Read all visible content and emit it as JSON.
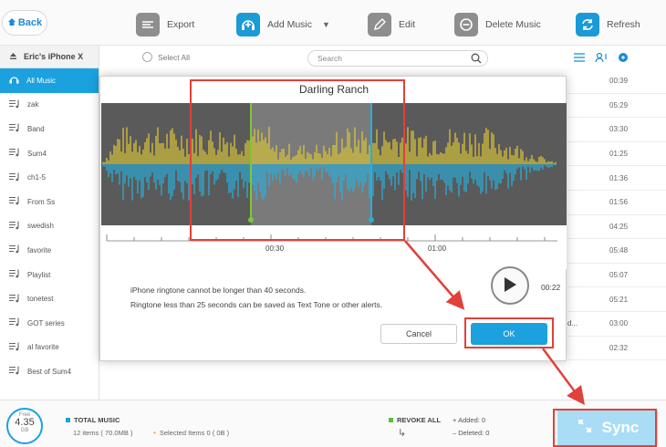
{
  "toolbar": {
    "back_label": "Back",
    "export_label": "Export",
    "add_music_label": "Add Music",
    "edit_label": "Edit",
    "delete_music_label": "Delete Music",
    "refresh_label": "Refresh"
  },
  "sidebar": {
    "device_name": "Eric's iPhone X",
    "items": [
      {
        "label": "All Music"
      },
      {
        "label": "zak"
      },
      {
        "label": "Band"
      },
      {
        "label": "Sum4"
      },
      {
        "label": "ch1-5"
      },
      {
        "label": "From Ss"
      },
      {
        "label": "swedish"
      },
      {
        "label": "favorite"
      },
      {
        "label": "Playlist"
      },
      {
        "label": "tonetest"
      },
      {
        "label": "GOT series"
      },
      {
        "label": "al favorite"
      },
      {
        "label": "Best of Sum4"
      }
    ]
  },
  "list": {
    "select_all_label": "Select All",
    "search_placeholder": "Search",
    "durations": [
      "00:39",
      "05:29",
      "03:30",
      "01:25",
      "01:36",
      "01:56",
      "04:25",
      "05:48",
      "05:07",
      "05:21",
      "03:00",
      "02:32"
    ],
    "row_ellipsis": "d..."
  },
  "dialog": {
    "title": "Darling Ranch",
    "tick_labels": [
      "00:30",
      "01:00"
    ],
    "note_line1": "iPhone ringtone cannot be longer than 40 seconds.",
    "note_line2": "Ringtone less than 25 seconds can be saved as Text Tone or other alerts.",
    "play_time": "00:22",
    "cancel_label": "Cancel",
    "ok_label": "OK"
  },
  "bottom": {
    "storage_free_label": "Free",
    "storage_value": "4.35",
    "storage_unit": "GB",
    "total_music_label": "TOTAL MUSIC",
    "total_items": "12 items ( 70.0MB )",
    "selected_items": "Selected Items 0 ( 0B )",
    "revoke_all_label": "REVOKE ALL",
    "added_label": "Added: 0",
    "deleted_label": "Deleted: 0",
    "sync_label": "Sync"
  },
  "colors": {
    "accent": "#1ba1de",
    "highlight": "#e0413a",
    "wave_yellow": "#d9c437",
    "wave_blue": "#2aaed9",
    "marker_green": "#7ec636"
  }
}
